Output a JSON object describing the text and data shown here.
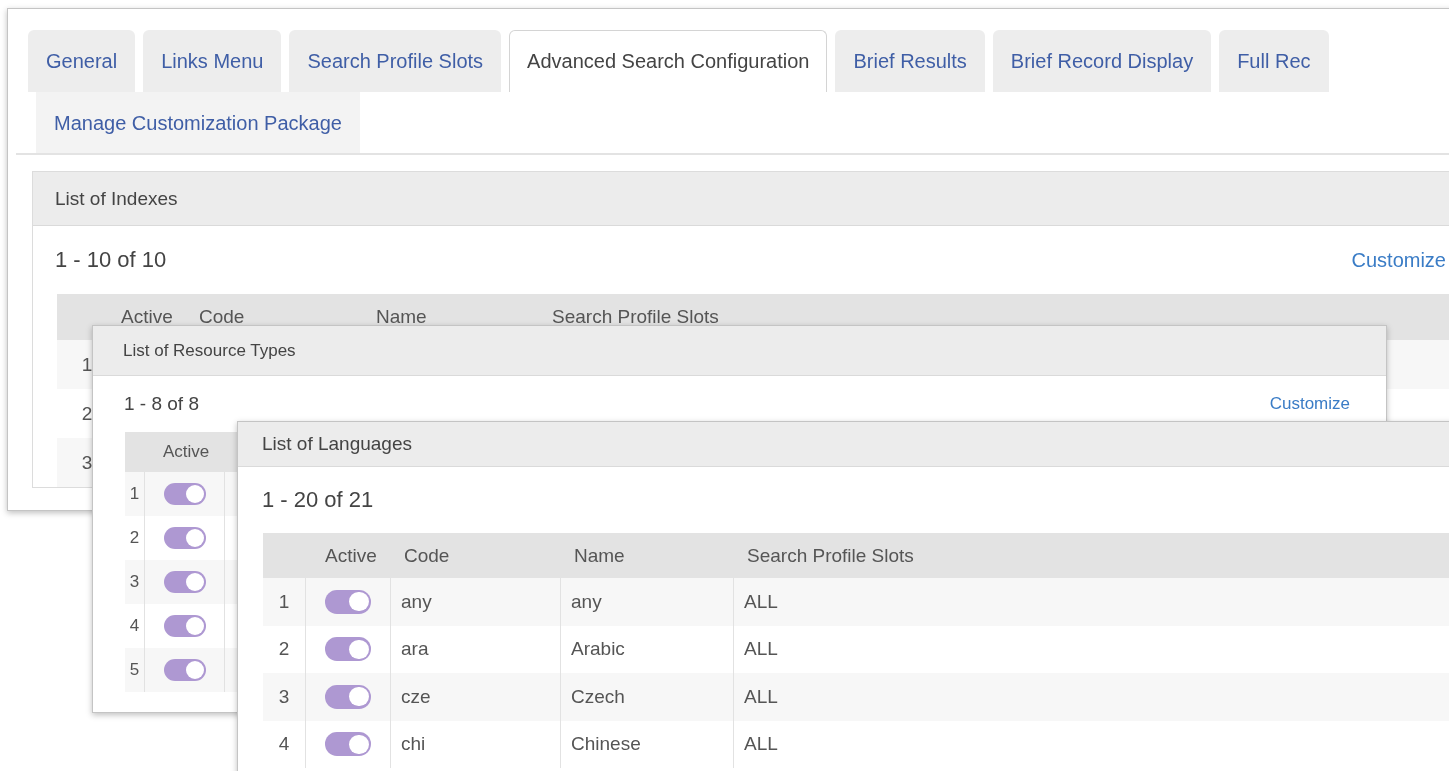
{
  "configuration_page": {
    "tabs": [
      {
        "label": "General",
        "selected": false
      },
      {
        "label": "Links Menu",
        "selected": false
      },
      {
        "label": "Search Profile Slots",
        "selected": false
      },
      {
        "label": "Advanced Search Configuration",
        "selected": true
      },
      {
        "label": "Brief Results",
        "selected": false
      },
      {
        "label": "Brief Record Display",
        "selected": false
      },
      {
        "label": "Full Rec",
        "selected": false
      },
      {
        "label": "Manage Customization Package",
        "selected": false
      }
    ],
    "section": {
      "title": "List of Indexes",
      "count": "1 - 10 of 10",
      "action": "Customize",
      "table": {
        "columns": [
          "Active",
          "Code",
          "Name",
          "Search Profile Slots"
        ],
        "rows": [
          {
            "number": "1"
          },
          {
            "number": "2"
          },
          {
            "number": "3"
          }
        ]
      }
    }
  },
  "resource_types_panel": {
    "title": "List of Resource Types",
    "count": "1 - 8 of 8",
    "action": "Customize",
    "table": {
      "columns": [
        "Active"
      ],
      "rows": [
        {
          "number": "1",
          "active": true
        },
        {
          "number": "2",
          "active": true
        },
        {
          "number": "3",
          "active": true
        },
        {
          "number": "4",
          "active": true
        },
        {
          "number": "5",
          "active": true
        }
      ]
    }
  },
  "languages_panel": {
    "title": "List of Languages",
    "count": "1 - 20 of 21",
    "table": {
      "columns": [
        "Active",
        "Code",
        "Name",
        "Search Profile Slots"
      ],
      "rows": [
        {
          "number": "1",
          "active": true,
          "code": "any",
          "name": "any",
          "slots": "ALL"
        },
        {
          "number": "2",
          "active": true,
          "code": "ara",
          "name": "Arabic",
          "slots": "ALL"
        },
        {
          "number": "3",
          "active": true,
          "code": "cze",
          "name": "Czech",
          "slots": "ALL"
        },
        {
          "number": "4",
          "active": true,
          "code": "chi",
          "name": "Chinese",
          "slots": "ALL"
        }
      ]
    }
  }
}
